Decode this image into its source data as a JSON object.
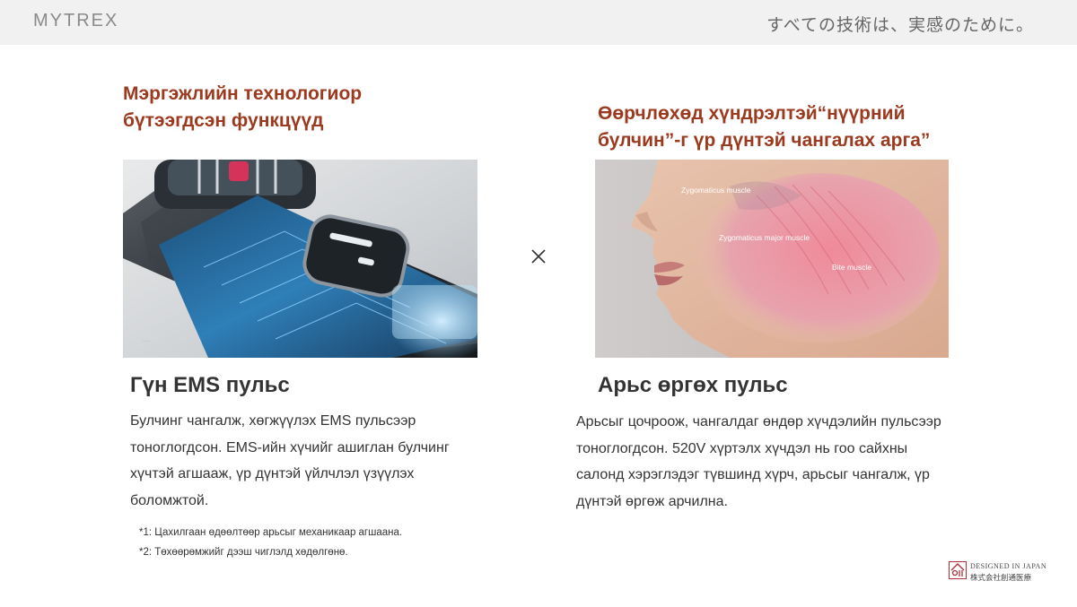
{
  "header": {
    "logo": "MYTREX",
    "tagline": "すべての技術は、実感のために。"
  },
  "left": {
    "headline_line1": "Мэргэжлийн технологиор",
    "headline_line2": "бүтээгдсэн функцүүд",
    "subtitle": "Гүн EMS пульс",
    "para_lines": [
      "Булчинг чангалж, хөгжүүлэх EMS пульсээр",
      "тоноглогдсон. EMS-ийн хүчийг ашиглан булчинг",
      "хүчтэй агшааж, үр дүнтэй үйлчлэл үзүүлэх",
      "боломжтой."
    ],
    "footnotes": [
      "*1: Цахилгаан өдөөлтөөр арьсыг механикаар агшаана.",
      "*2: Төхөөрөмжийг дээш чиглэлд хөдөлгөнө."
    ]
  },
  "right": {
    "headline_line1": "Өөрчлөхөд хүндрэлтэй“нүүрний",
    "headline_line2": "булчин”-г үр дүнтэй чангалах арга”",
    "subtitle": "Арьс өргөх пульс",
    "para_lines": [
      "Арьсыг цочроож, чангалдаг өндөр хүчдэлийн пульсээр",
      "тоноглогдсон. 520V хүртэлх хүчдэл нь гоо сайхны",
      "салонд хэрэглэдэг түвшинд хүрч, арьсыг чангалж, үр",
      "дүнтэй өргөж арчилна."
    ],
    "muscle_labels": [
      "Zygomaticus muscle",
      "Zygomaticus major muscle",
      "Bite muscle"
    ]
  },
  "badge": {
    "line1": "DESIGNED IN JAPAN",
    "line2": "株式会社創通医療"
  },
  "icons": {
    "multiply": "multiply-icon",
    "brand_mark": "brand-mark-icon"
  },
  "colors": {
    "headline": "#9c3a1f",
    "topbar": "#f1f1f1",
    "logo": "#8a8a8a"
  }
}
